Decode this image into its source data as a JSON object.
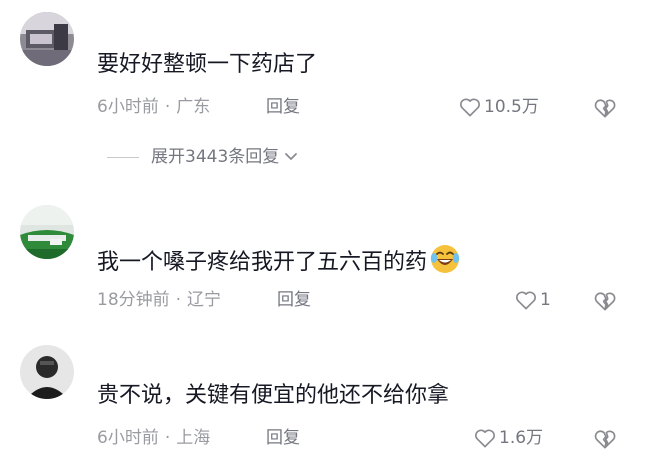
{
  "comments": [
    {
      "text": "要好好整顿一下药店了",
      "time": "6小时前",
      "location": "广东",
      "reply_label": "回复",
      "likes": "10.5万",
      "expand_label": "展开3443条回复"
    },
    {
      "text": "我一个嗓子疼给我开了五六百的药",
      "emoji": "laughing-crying-emoji",
      "time": "18分钟前",
      "location": "辽宁",
      "reply_label": "回复",
      "likes": "1"
    },
    {
      "text": "贵不说，关键有便宜的他还不给你拿",
      "time": "6小时前",
      "location": "上海",
      "reply_label": "回复",
      "likes": "1.6万"
    }
  ],
  "separator": "·",
  "colors": {
    "text": "#161823",
    "meta": "#9a9ba1",
    "action": "#757780",
    "emoji": "#f7c23b"
  }
}
